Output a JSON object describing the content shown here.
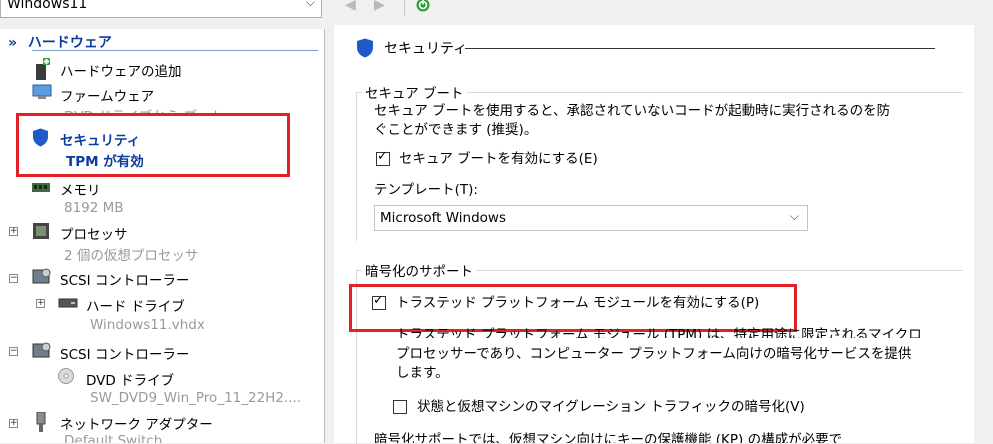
{
  "toolbar": {
    "vm_name": "Windows11",
    "back_glyph": "◀",
    "forward_glyph": "▶"
  },
  "tree": {
    "hardware_header": "ハードウェア",
    "add_hardware": "ハードウェアの追加",
    "firmware": {
      "label": "ファームウェア",
      "sub": "DVD ドライブから ブート"
    },
    "security": {
      "label": "セキュリティ",
      "sub": "TPM が有効"
    },
    "memory": {
      "label": "メモリ",
      "sub": "8192 MB"
    },
    "processor": {
      "label": "プロセッサ",
      "sub": "2 個の仮想プロセッサ"
    },
    "scsi1": {
      "label": "SCSI コントローラー"
    },
    "harddrive": {
      "label": "ハード ドライブ",
      "sub": "Windows11.vhdx"
    },
    "scsi2": {
      "label": "SCSI コントローラー"
    },
    "dvd": {
      "label": "DVD ドライブ",
      "sub": "SW_DVD9_Win_Pro_11_22H2...."
    },
    "network": {
      "label": "ネットワーク アダプター",
      "sub": "Default Switch"
    }
  },
  "security_panel": {
    "title": "セキュリティ",
    "secure_boot": {
      "group_label": "セキュア ブート",
      "description_line1": "セキュア ブートを使用すると、承認されていないコードが起動時に実行されるのを防",
      "description_line2": "ぐことができます (推奨)。",
      "enable_label": "セキュア ブートを有効にする(E)",
      "enable_checked": true,
      "template_label": "テンプレート(T):",
      "template_value": "Microsoft Windows"
    },
    "encryption": {
      "group_label": "暗号化のサポート",
      "tpm_label": "トラステッド プラットフォーム モジュールを有効にする(P)",
      "tpm_checked": true,
      "tpm_desc_line1": "トラステッド プラットフォーム モジュール (TPM) は、特定用途に限定されるマイクロ",
      "tpm_desc_line2": "プロセッサーであり、コンピューター プラットフォーム向けの暗号化サービスを提供",
      "tpm_desc_line3": "します。",
      "migration_label": "状態と仮想マシンのマイグレーション トラフィックの暗号化(V)",
      "migration_checked": false,
      "footer_line": "暗号化サポートでは、仮想マシン向けにキーの保護機能 (KP) の構成が必要で"
    }
  },
  "colors": {
    "accent_blue": "#0b3c9b",
    "highlight_red": "#e12127",
    "shield_blue": "#1e5bc6",
    "start_green": "#2e9e3a"
  }
}
